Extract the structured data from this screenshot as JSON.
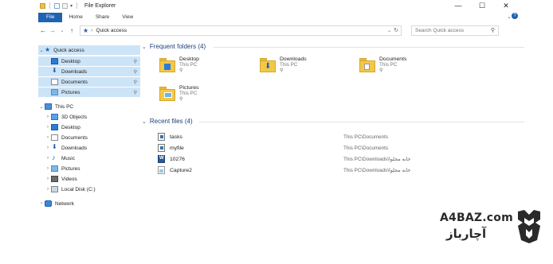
{
  "window": {
    "title": "File Explorer",
    "controls": [
      "—",
      "☐",
      "✕"
    ]
  },
  "ribbon": {
    "tabs": [
      "File",
      "Home",
      "Share",
      "View"
    ]
  },
  "address_bar": {
    "crumb": "Quick access"
  },
  "search": {
    "placeholder": "Search Quick access"
  },
  "nav": {
    "quick_access": "Quick access",
    "quick_items": [
      "Desktop",
      "Downloads",
      "Documents",
      "Pictures"
    ],
    "this_pc": "This PC",
    "pc_items": [
      "3D Objects",
      "Desktop",
      "Documents",
      "Downloads",
      "Music",
      "Pictures",
      "Videos",
      "Local Disk (C:)"
    ],
    "network": "Network"
  },
  "frequent": {
    "heading": "Frequent folders (4)",
    "folders": [
      {
        "name": "Desktop",
        "location": "This PC"
      },
      {
        "name": "Downloads",
        "location": "This PC"
      },
      {
        "name": "Documents",
        "location": "This PC"
      },
      {
        "name": "Pictures",
        "location": "This PC"
      }
    ]
  },
  "recent": {
    "heading": "Recent files (4)",
    "files": [
      {
        "name": "tasks",
        "path": "This PC\\Documents"
      },
      {
        "name": "myfile",
        "path": "This PC\\Documents"
      },
      {
        "name": "10276",
        "path": "This PC\\Downloads\\خانه مجلوا"
      },
      {
        "name": "Capture2",
        "path": "This PC\\Downloads\\خانه مجلوا"
      }
    ]
  },
  "watermark": {
    "latin": "A4BAZ.com",
    "persian": "آچارباز"
  }
}
